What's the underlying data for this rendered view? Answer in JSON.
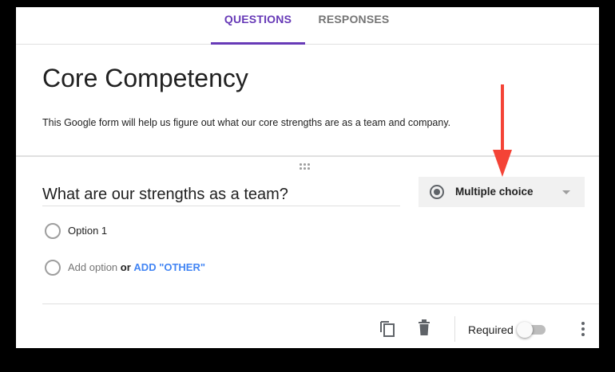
{
  "tabs": {
    "questions": "QUESTIONS",
    "responses": "RESPONSES",
    "active": "QUESTIONS",
    "accent_color": "#673ab7"
  },
  "form": {
    "title": "Core Competency",
    "description": "This Google form will help us figure out what our core strengths are as a team and company."
  },
  "question": {
    "title": "What are our strengths as a team?",
    "type_label": "Multiple choice",
    "type_icon": "radio-button-icon",
    "options": [
      "Option 1"
    ],
    "add_option": "Add option",
    "or_text": "or",
    "add_other": "ADD \"OTHER\"",
    "link_color": "#4285f4"
  },
  "footer": {
    "icons": [
      "copy-icon",
      "trash-icon",
      "more-vert-icon"
    ],
    "required_label": "Required",
    "required_on": false
  },
  "annotation": {
    "arrow_color": "#f44336"
  }
}
